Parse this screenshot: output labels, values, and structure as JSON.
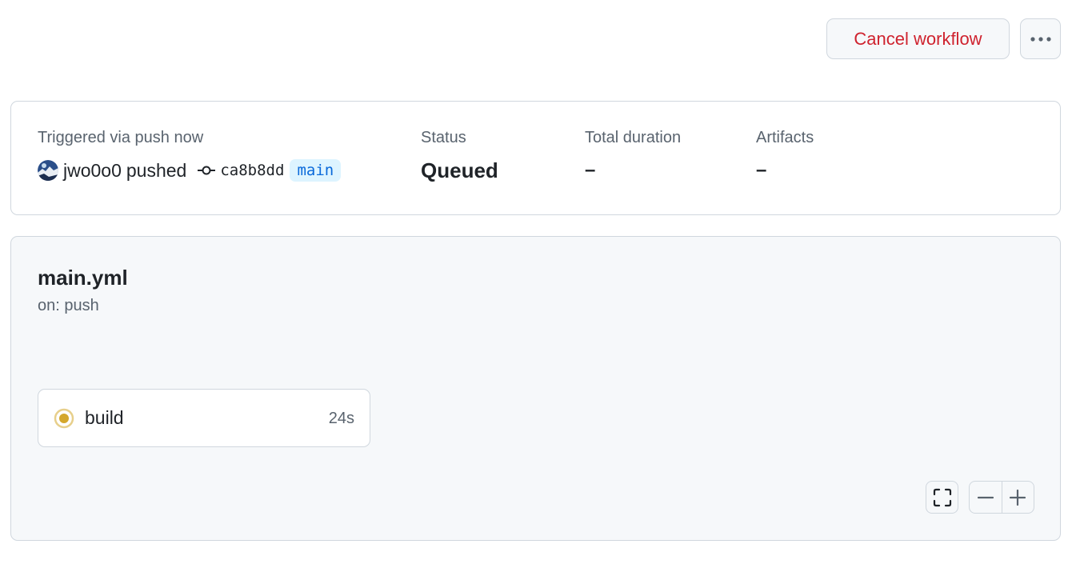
{
  "header": {
    "cancel_label": "Cancel workflow",
    "more_icon": "kebab-horizontal-icon"
  },
  "summary": {
    "trigger_label": "Triggered via push now",
    "actor": "jwo0o0",
    "action": "pushed",
    "commit_sha": "ca8b8dd",
    "branch": "main",
    "status_label": "Status",
    "status_value": "Queued",
    "duration_label": "Total duration",
    "duration_value": "–",
    "artifacts_label": "Artifacts",
    "artifacts_value": "–"
  },
  "workflow": {
    "file": "main.yml",
    "trigger": "on: push",
    "jobs": [
      {
        "name": "build",
        "duration": "24s",
        "status": "queued",
        "status_icon": "queued-dot-icon"
      }
    ]
  },
  "graph_controls": {
    "fullscreen_icon": "screen-full-icon",
    "zoom_out_icon": "minus-icon",
    "zoom_in_icon": "plus-icon"
  },
  "colors": {
    "danger": "#cf222e",
    "queued": "#d4a72c",
    "branch_bg": "#ddf4ff",
    "branch_fg": "#0969da",
    "border": "#d0d7de",
    "canvas": "#f6f8fa"
  }
}
